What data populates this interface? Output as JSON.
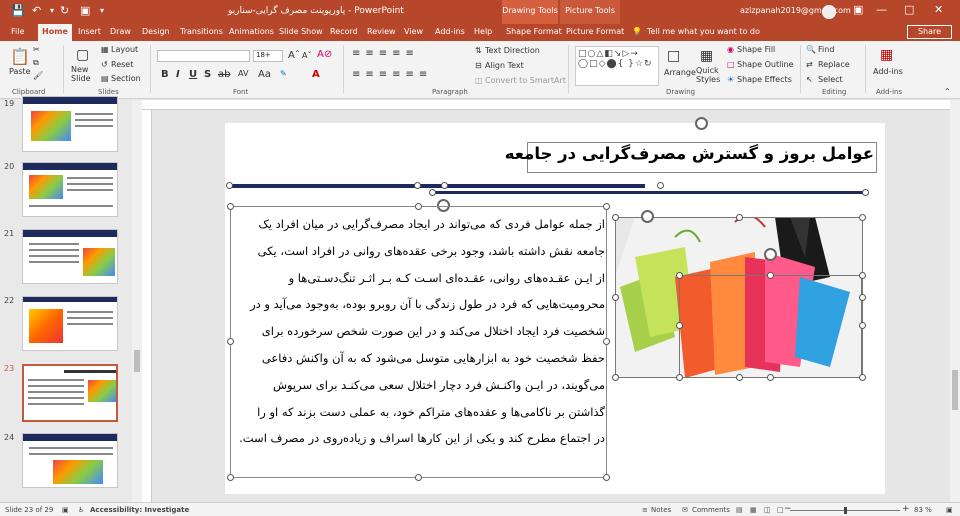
{
  "titlebar": {
    "title": "پاورپوینت مصرف گرایی-سناریو  -  PowerPoint",
    "context_drawing": "Drawing Tools",
    "context_picture": "Picture Tools",
    "user": "azizpanah2019@gmail.com",
    "accent": "#b7472a"
  },
  "tabs": [
    "File",
    "Home",
    "Insert",
    "Draw",
    "Design",
    "Transitions",
    "Animations",
    "Slide Show",
    "Record",
    "Review",
    "View",
    "Add-ins",
    "Help",
    "Shape Format",
    "Picture Format"
  ],
  "tell_me": "Tell me what you want to do",
  "share": "Share",
  "ribbon": {
    "paste": "Paste",
    "new_slide": "New Slide",
    "layout": "Layout",
    "reset": "Reset",
    "section": "Section",
    "font_size": "18+",
    "text_direction": "Text Direction",
    "align_text": "Align Text",
    "convert_smartart": "Convert to SmartArt",
    "arrange": "Arrange",
    "quick_styles": "Quick Styles",
    "shape_fill": "Shape Fill",
    "shape_outline": "Shape Outline",
    "shape_effects": "Shape Effects",
    "find": "Find",
    "replace": "Replace",
    "select": "Select",
    "addins": "Add-ins",
    "groups": {
      "clipboard": "Clipboard",
      "slides": "Slides",
      "font": "Font",
      "paragraph": "Paragraph",
      "drawing": "Drawing",
      "editing": "Editing",
      "addins": "Add-ins"
    }
  },
  "thumbnails": [
    {
      "num": "19"
    },
    {
      "num": "20"
    },
    {
      "num": "21"
    },
    {
      "num": "22"
    },
    {
      "num": "23"
    },
    {
      "num": "24"
    }
  ],
  "slide": {
    "title": "عوامل بروز و گسترش مصرف‌گرایی در جامعه",
    "body_lines": [
      "از جمله عوامل فردی که می‌تواند در ایجاد مصرف‌گرایی در میان افراد یک",
      "جامعه نقش داشته باشد، وجود برخی عقده‌های روانی در افراد است، یکی",
      "از ایـن عقـده‌های روانی، عقـده‌ای اسـت کـه بـر اثـر تنگ‌دسـتی‌ها و",
      "محرومیت‌هایی که فرد در طول زندگی با آن روبرو بوده، به‌وجود می‌آید و در",
      "شخصیت فرد ایجاد اختلال می‌کند و در این صورت شخص سرخورده برای",
      "حفظ شخصیت خود به ابزارهایی متوسل می‌شود که به آن واکنش دفاعی",
      "می‌گویند، در ایـن واکنـش فرد دچار اختلال سعی می‌کنـد برای سرپوش",
      "گذاشتن بر ناکامی‌ها و عقده‌های متراکم خود، به عملی دست بزند که او را",
      "در اجتماع مطرح کند و یکی از این کارها اسراف و زیاده‌روی در مصرف است."
    ],
    "line_color": "#1f2a5c"
  },
  "status": {
    "slide_info": "Slide 23 of 29",
    "accessibility": "Accessibility: Investigate",
    "notes": "Notes",
    "comments": "Comments",
    "zoom": "83 %"
  }
}
